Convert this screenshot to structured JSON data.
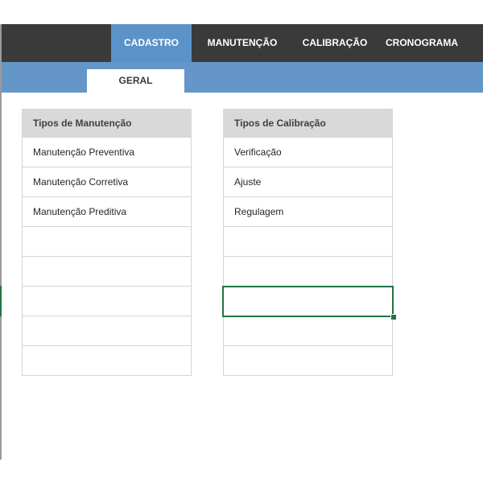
{
  "nav": {
    "tabs": [
      {
        "label": "CADASTRO",
        "active": true
      },
      {
        "label": "MANUTENÇÃO",
        "active": false
      },
      {
        "label": "CALIBRAÇÃO",
        "active": false
      },
      {
        "label": "CRONOGRAMA",
        "active": false
      }
    ]
  },
  "subnav": {
    "tabs": [
      {
        "label": "GERAL",
        "active": true
      }
    ]
  },
  "tables": {
    "manutencao": {
      "header": "Tipos de Manutenção",
      "rows": [
        "Manutenção Preventiva",
        "Manutenção Corretiva",
        "Manutenção Preditiva",
        "",
        "",
        "",
        "",
        ""
      ]
    },
    "calibracao": {
      "header": "Tipos de Calibração",
      "rows": [
        "Verificação",
        "Ajuste",
        "Regulagem",
        "",
        "",
        "",
        "",
        ""
      ]
    }
  },
  "colors": {
    "nav_bg": "#3a3a3a",
    "active_tab": "#5b93c9",
    "subbar": "#6496c8",
    "header_bg": "#d9d9d9",
    "selection": "#217346"
  }
}
